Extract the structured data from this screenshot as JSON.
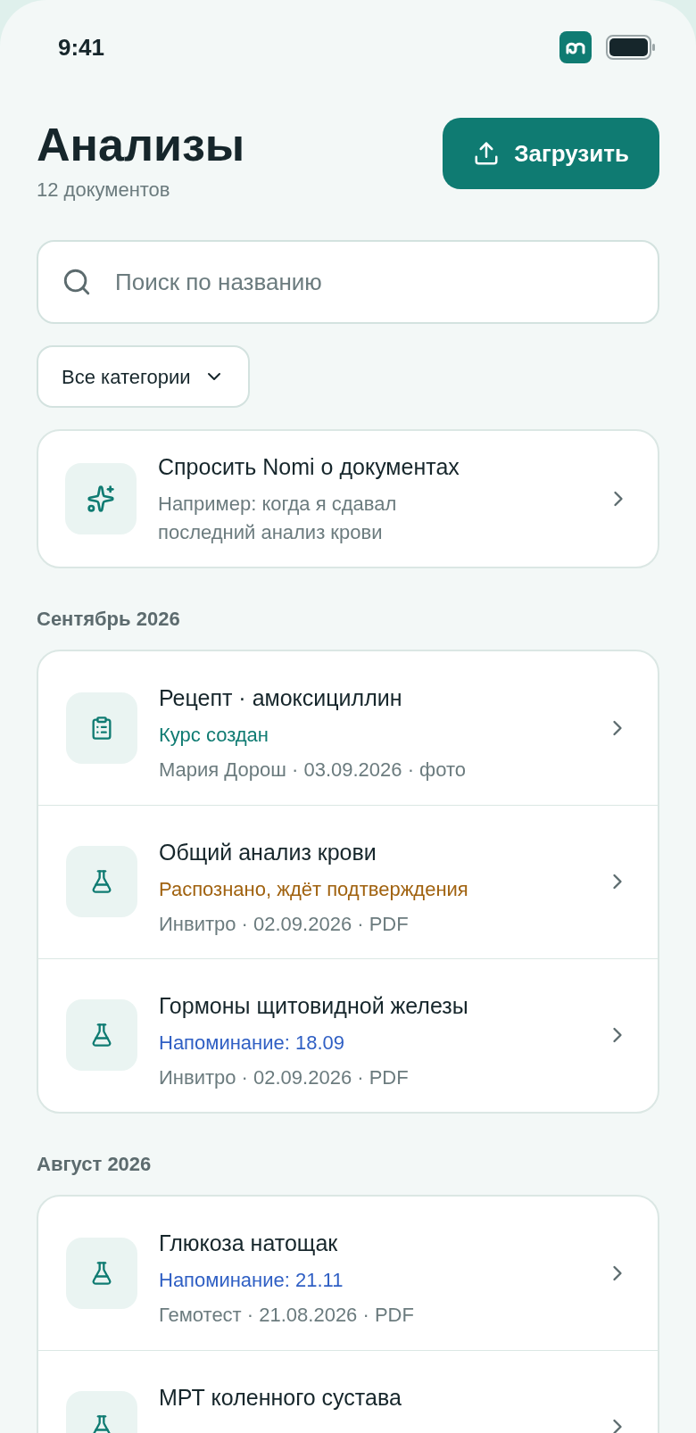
{
  "status_bar": {
    "time": "9:41"
  },
  "header": {
    "title": "Анализы",
    "subtitle": "12 документов",
    "upload_button": "Загрузить"
  },
  "search": {
    "placeholder": "Поиск по названию"
  },
  "filter": {
    "label": "Все категории"
  },
  "assistant_card": {
    "title": "Спросить Nomi о документах",
    "hint": "Например: когда я сдавал последний анализ крови"
  },
  "sections": [
    {
      "heading": "Сентябрь 2026",
      "documents": [
        {
          "kind": "prescription",
          "title": "Рецепт · амоксициллин",
          "status": {
            "kind": "done",
            "text": "Курс создан"
          },
          "meta": "Мария Дорош · 03.09.2026 · фото"
        },
        {
          "kind": "lab",
          "title": "Общий анализ крови",
          "status": {
            "kind": "pending",
            "text": "Распознано, ждёт подтверждения"
          },
          "meta": "Инвитро · 02.09.2026 · PDF"
        },
        {
          "kind": "lab",
          "title": "Гормоны щитовидной железы",
          "status": {
            "kind": "reminder",
            "text": "Напоминание: 18.09"
          },
          "meta": "Инвитро · 02.09.2026 · PDF"
        }
      ]
    },
    {
      "heading": "Август 2026",
      "documents": [
        {
          "kind": "lab",
          "title": "Глюкоза натощак",
          "status": {
            "kind": "reminder",
            "text": "Напоминание: 21.11"
          },
          "meta": "Гемотест · 21.08.2026 · PDF"
        },
        {
          "kind": "lab",
          "title": "МРТ коленного сустава"
        }
      ]
    }
  ]
}
